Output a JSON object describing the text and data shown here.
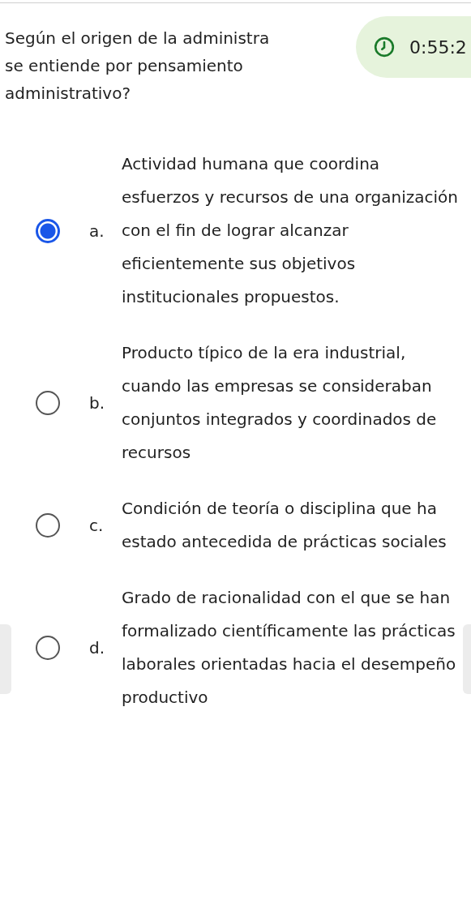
{
  "question": {
    "first_line": "Según el origen de la administra",
    "rest": "se entiende por pensamiento administrativo?"
  },
  "timer": {
    "time": "0:55:2"
  },
  "options": [
    {
      "letter": "a.",
      "text": "Actividad humana que coordina esfuerzos y recursos de una organización con el fin de lograr alcanzar eficientemente sus objetivos institucionales propuestos.",
      "selected": true
    },
    {
      "letter": "b.",
      "text": "Producto típico de la era industrial, cuando las empresas se consideraban conjuntos integrados y coordinados de recursos",
      "selected": false
    },
    {
      "letter": "c.",
      "text": "Condición de teoría o disciplina que ha estado antecedida de prácticas sociales",
      "selected": false
    },
    {
      "letter": "d.",
      "text": "Grado de racionalidad con el que se han formalizado científicamente las prácticas laborales orientadas hacia el desempeño productivo",
      "selected": false
    }
  ]
}
